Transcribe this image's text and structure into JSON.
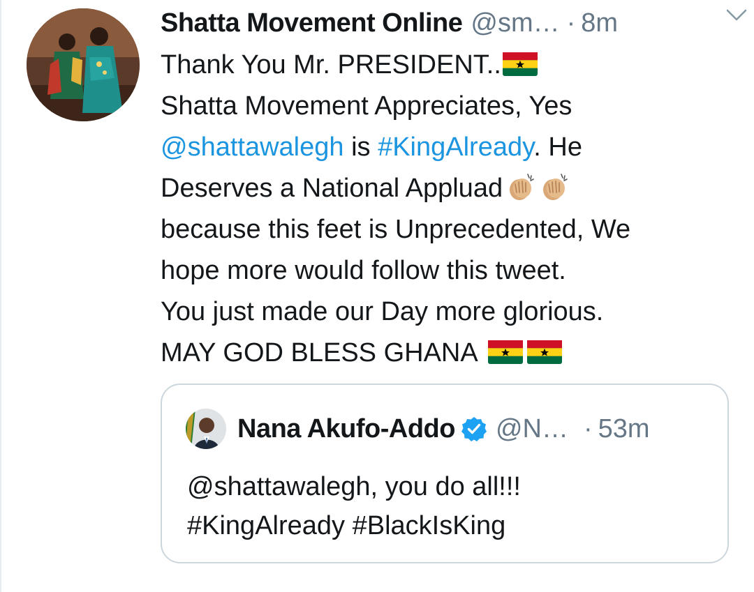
{
  "tweet": {
    "author_name": "Shatta Movement Online",
    "author_handle": "@sm…",
    "dot": "·",
    "timestamp": "8m",
    "body": {
      "line1": "Thank You Mr. PRESIDENT..",
      "line2": "Shatta Movement Appreciates, Yes",
      "line3_mention": "@shattawalegh",
      "line3_mid": " is ",
      "line3_hashtag": "#KingAlready",
      "line3_end": ". He",
      "line4": "Deserves a National Appluad",
      "line5": "because this feet is Unprecedented, We",
      "line6": "hope more would follow this tweet.",
      "line7": "You just made our Day more glorious.",
      "line8": "MAY GOD BLESS GHANA"
    },
    "emoji": {
      "flag": "ghana-flag-icon",
      "clap": "clapping-hands-icon"
    }
  },
  "quoted_tweet": {
    "author_name": "Nana Akufo-Addo",
    "verified": true,
    "author_handle": "@N…",
    "dot": "·",
    "timestamp": "53m",
    "line1": "@shattawalegh, you do all!!!",
    "line2": "#KingAlready #BlackIsKing"
  },
  "colors": {
    "link": "#1b95e0",
    "secondary_text": "#657786",
    "primary_text": "#14171a",
    "border": "#ccd6dd",
    "verified": "#1da1f2",
    "flag_red": "#ce1126",
    "flag_gold": "#fcd116",
    "flag_green": "#006b3f"
  }
}
